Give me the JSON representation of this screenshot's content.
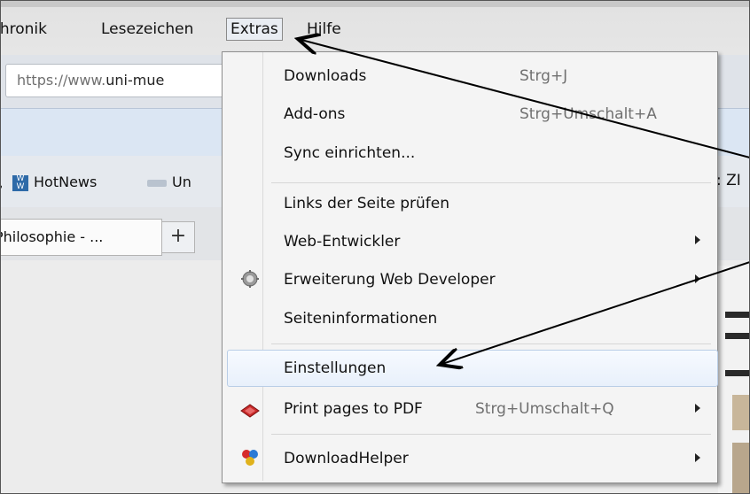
{
  "menubar": {
    "items": [
      {
        "label": "Chronik",
        "partial_visible": "Chronik"
      },
      {
        "label": "Lesezeichen"
      },
      {
        "label": "Extras"
      },
      {
        "label": "Hilfe"
      }
    ]
  },
  "urlbar": {
    "prefix": "https://www.",
    "domain": "uni-mue"
  },
  "bookmarks": {
    "items": [
      {
        "label": "HotNews",
        "icon": "ww-icon"
      },
      {
        "label": "Un",
        "icon": "folder-icon"
      }
    ]
  },
  "tabs": {
    "active": "Philosophie - ...",
    "new_tab_label": "+"
  },
  "edge_text": {
    "bookmarks_right": ": ZI"
  },
  "extras_menu": {
    "items": [
      {
        "label": "Downloads",
        "shortcut": "Strg+J"
      },
      {
        "label": "Add-ons",
        "shortcut": "Strg+Umschalt+A"
      },
      {
        "label": "Sync einrichten..."
      },
      {
        "label": "Links der Seite prüfen"
      },
      {
        "label": "Web-Entwickler",
        "submenu": true
      },
      {
        "label": "Erweiterung Web Developer",
        "submenu": true,
        "icon": "gear-icon"
      },
      {
        "label": "Seiteninformationen"
      },
      {
        "label": "Einstellungen",
        "highlighted": true
      },
      {
        "label": "Print pages to PDF",
        "shortcut": "Strg+Umschalt+Q",
        "submenu": true,
        "icon": "pdf-icon"
      },
      {
        "label": "DownloadHelper",
        "submenu": true,
        "icon": "downloadhelper-icon"
      }
    ]
  }
}
